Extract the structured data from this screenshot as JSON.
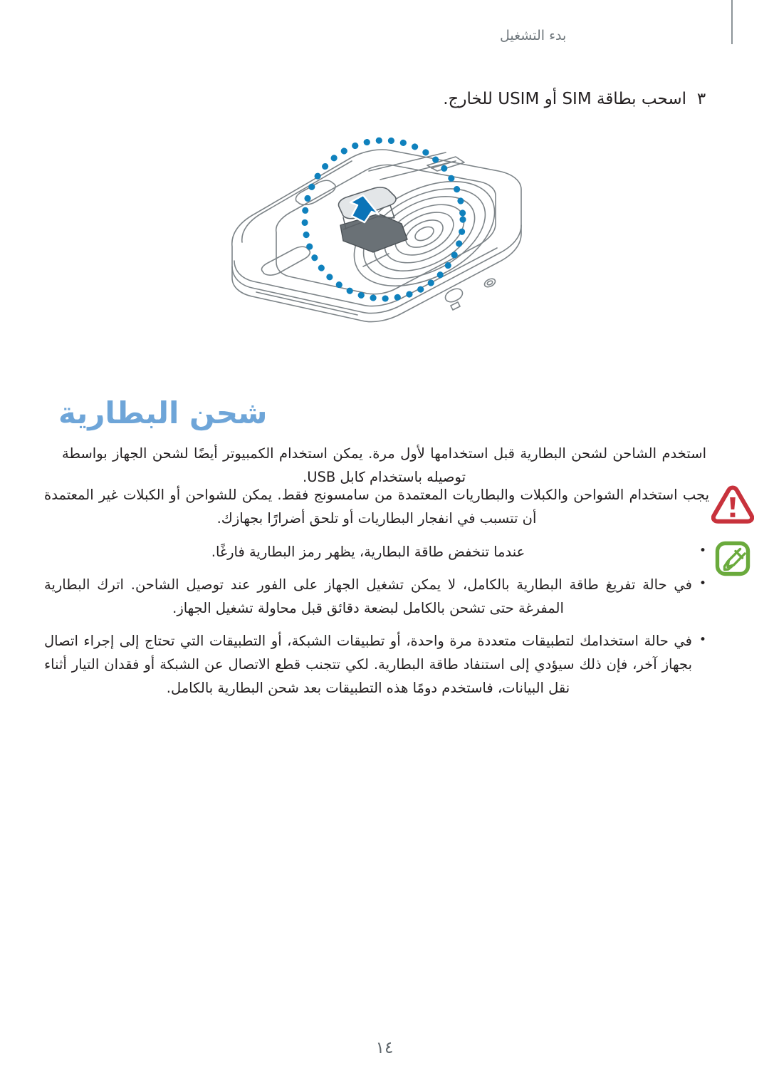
{
  "header": {
    "title": "بدء التشغيل"
  },
  "step": {
    "number": "٣",
    "text": "اسحب بطاقة SIM أو USIM للخارج."
  },
  "figure": {
    "name": "sim-card-removal-illustration",
    "highlight_circle_color": "#0f81bd",
    "arrow_color": "#0b74b8",
    "device_line_color": "#7d8488",
    "tray_fill": "#6a7176"
  },
  "section": {
    "heading": "شحن البطارية",
    "heading_color": "#6ea5d8",
    "intro": "استخدم الشاحن لشحن البطارية قبل استخدامها لأول مرة. يمكن استخدام الكمبيوتر أيضًا لشحن الجهاز بواسطة توصيله باستخدام كابل USB."
  },
  "warning": {
    "icon": "warning-triangle-icon",
    "color": "#c8323c",
    "text": "يجب استخدام الشواحن والكبلات والبطاريات المعتمدة من سامسونج فقط. يمكن للشواحن أو الكبلات غير المعتمدة أن تتسبب في انفجار البطاريات أو تلحق أضرارًا بجهازك."
  },
  "note": {
    "icon": "note-pencil-icon",
    "color": "#6aaa3c",
    "items": [
      "عندما تنخفض طاقة البطارية، يظهر رمز البطارية فارغًا.",
      "في حالة تفريغ طاقة البطارية بالكامل، لا يمكن تشغيل الجهاز على الفور عند توصيل الشاحن. اترك البطارية المفرغة حتى تشحن بالكامل لبضعة دقائق قبل محاولة تشغيل الجهاز.",
      "في حالة استخدامك لتطبيقات متعددة مرة واحدة، أو تطبيقات الشبكة، أو التطبيقات التي تحتاج إلى إجراء اتصال بجهاز آخر، فإن ذلك سيؤدي إلى استنفاد طاقة البطارية. لكي تتجنب قطع الاتصال عن الشبكة أو فقدان التيار أثناء نقل البيانات، فاستخدم دومًا هذه التطبيقات بعد شحن البطارية بالكامل."
    ]
  },
  "footer": {
    "page_number": "١٤"
  }
}
